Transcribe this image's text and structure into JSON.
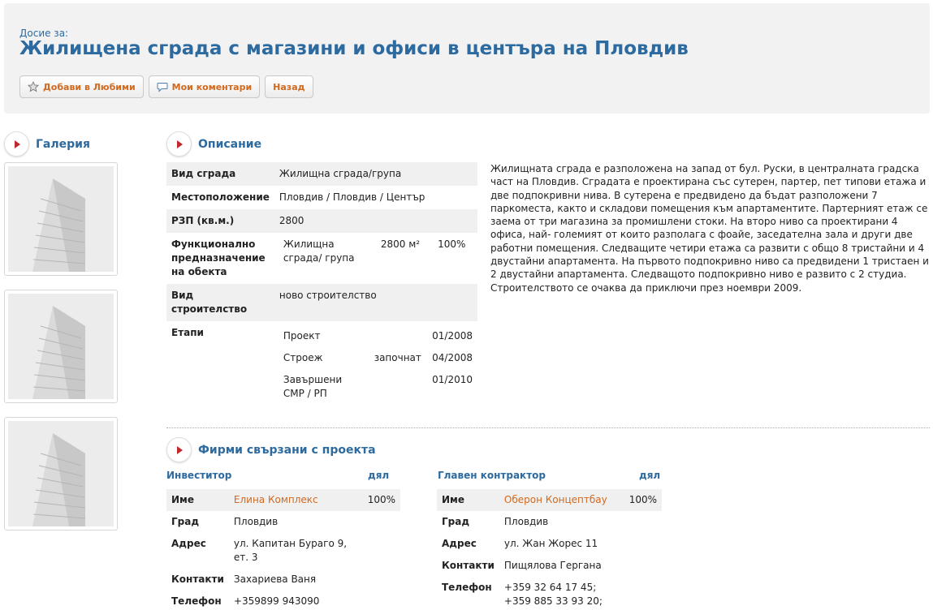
{
  "header": {
    "dossier_label": "Досие за:",
    "title": "Жилищена сграда с магазини и офиси в центъра на Пловдив",
    "buttons": {
      "favorites": "Добави в Любими",
      "comments": "Мои коментари",
      "back": "Назад"
    }
  },
  "gallery": {
    "title": "Галерия"
  },
  "description": {
    "title": "Описание",
    "rows": {
      "building_type": {
        "label": "Вид сграда",
        "value": "Жилищна сграда/група"
      },
      "location": {
        "label": "Местоположение",
        "value": "Пловдив / Пловдив / Център"
      },
      "area": {
        "label": "РЗП (кв.м.)",
        "value": "2800"
      },
      "purpose": {
        "label": "Функционално предназначение на обекта",
        "type": "Жилищна сграда/ група",
        "area": "2800 м²",
        "share": "100%"
      },
      "construction": {
        "label": "Вид строителство",
        "value": "ново строителство"
      },
      "stages": {
        "label": "Етапи",
        "items": [
          {
            "name": "Проект",
            "status": "",
            "date": "01/2008"
          },
          {
            "name": "Строеж",
            "status": "започнат",
            "date": "04/2008"
          },
          {
            "name": "Завършени СМР / РП",
            "status": "",
            "date": "01/2010"
          }
        ]
      }
    },
    "text": "Жилищната сграда е разположена на запад от бул. Руски, в централната градска част на Пловдив. Сградата е проектирана със сутерен, партер, пет типови етажа и две подпокривни нива. В сутерена е предвидено да бъдат разположени 7 паркоместа, както и складови помещения към апартаментите. Партерният етаж се заема от три магазина за промишлени стоки. На второ ниво са проектирани 4 офиса, най- големият от които разполага с фоайе, заседателна зала и други две работни помещения. Следващите четири етажа са развити с общо 8 тристайни и 4 двустайни апартамента. На първото подпокривно ниво са предвидени 1 тристаен и 2 двустайни апартамента. Следващото подпокривно ниво е развито с 2 студиа. Строителството се очаква да приключи през ноември 2009."
  },
  "firms": {
    "title": "Фирми свързани с проекта",
    "share_label": "дял",
    "labels": {
      "name": "Име",
      "city": "Град",
      "address": "Адрес",
      "contacts": "Контакти",
      "phone": "Телефон"
    },
    "investor": {
      "role": "Инвеститор",
      "name": "Елина Комплекс",
      "share": "100%",
      "city": "Пловдив",
      "address": "ул. Капитан Бураго 9, ет. 3",
      "contacts": "Захариева Ваня",
      "phone": "+359899 943090"
    },
    "contractor": {
      "role": "Главен контрактор",
      "name": "Оберон Концептбау",
      "share": "100%",
      "city": "Пловдив",
      "address": "ул. Жан Жорес 11",
      "contacts": "Пищялова Гергана",
      "phone": "+359 32 64 17 45; +359 885 33 93 20;"
    }
  },
  "colors": {
    "title_blue": "#2d6a9f",
    "link_orange": "#d2691e",
    "bullet_red": "#c0282d"
  }
}
